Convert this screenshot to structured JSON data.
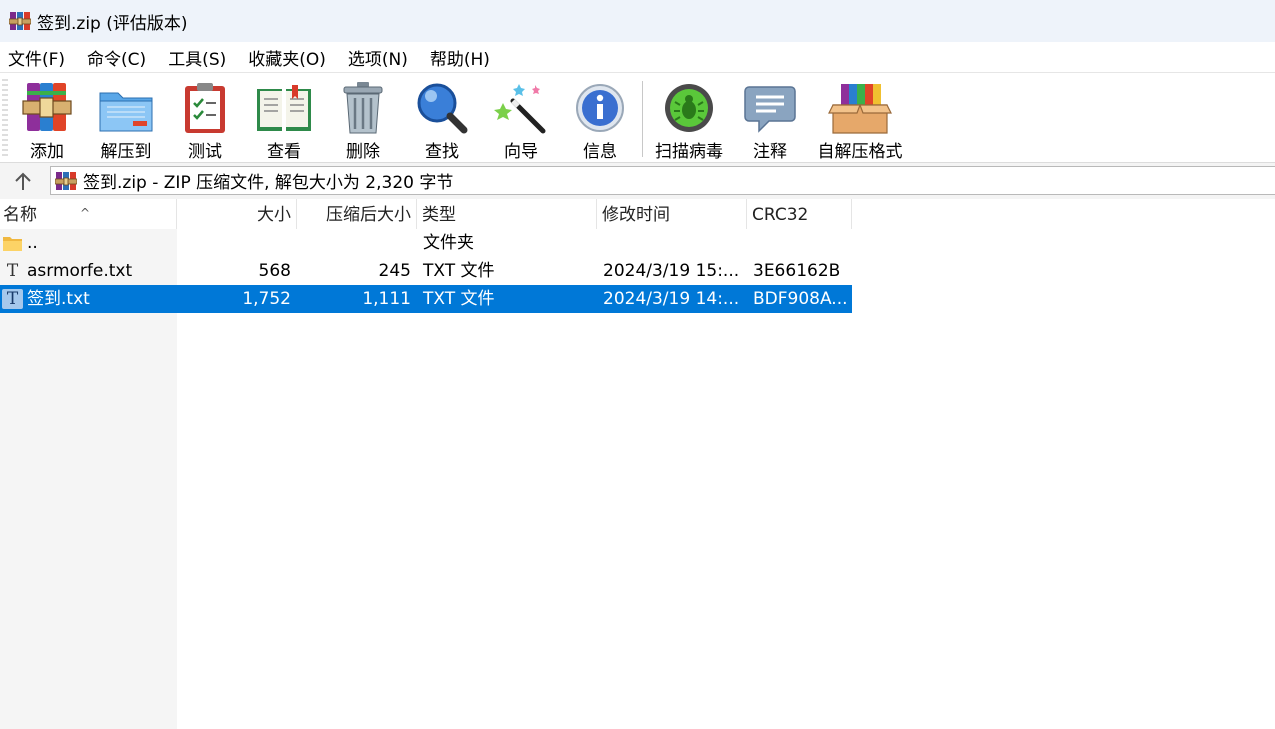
{
  "window": {
    "title": "签到.zip (评估版本)"
  },
  "menu": [
    "文件(F)",
    "命令(C)",
    "工具(S)",
    "收藏夹(O)",
    "选项(N)",
    "帮助(H)"
  ],
  "toolbar": {
    "add": "添加",
    "extract": "解压到",
    "test": "测试",
    "view": "查看",
    "delete": "删除",
    "find": "查找",
    "wizard": "向导",
    "info": "信息",
    "virus": "扫描病毒",
    "comment": "注释",
    "sfx": "自解压格式"
  },
  "address": {
    "text": "签到.zip - ZIP 压缩文件, 解包大小为 2,320 字节"
  },
  "columns": {
    "name": "名称",
    "size": "大小",
    "packed": "压缩后大小",
    "type": "类型",
    "modified": "修改时间",
    "crc": "CRC32"
  },
  "rows": [
    {
      "name": "..",
      "size": "",
      "packed": "",
      "type": "文件夹",
      "modified": "",
      "crc": "",
      "icon": "folder-icon"
    },
    {
      "name": "asrmorfe.txt",
      "size": "568",
      "packed": "245",
      "type": "TXT 文件",
      "modified": "2024/3/19 15:...",
      "crc": "3E66162B",
      "icon": "text-file-icon"
    },
    {
      "name": "签到.txt",
      "size": "1,752",
      "packed": "1,111",
      "type": "TXT 文件",
      "modified": "2024/3/19 14:...",
      "crc": "BDF908A...",
      "icon": "text-file-icon",
      "selected": true
    }
  ],
  "colors": {
    "selection": "#0078d7",
    "titlebar": "#eef3fa"
  }
}
